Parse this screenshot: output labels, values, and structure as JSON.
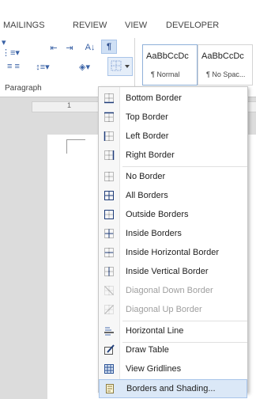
{
  "ribbon": {
    "tabs": [
      "MAILINGS",
      "REVIEW",
      "VIEW",
      "DEVELOPER"
    ],
    "group_label": "Paragraph",
    "styles": [
      {
        "sample": "AaBbCcDc",
        "name": "¶ Normal"
      },
      {
        "sample": "AaBbCcDc",
        "name": "¶ No Spac..."
      }
    ]
  },
  "ruler": {
    "number": "1"
  },
  "menu": {
    "items": [
      {
        "label": "Bottom Border",
        "icon": "bottom-border-icon",
        "enabled": true
      },
      {
        "label": "Top Border",
        "icon": "top-border-icon",
        "enabled": true
      },
      {
        "label": "Left Border",
        "icon": "left-border-icon",
        "enabled": true
      },
      {
        "label": "Right Border",
        "icon": "right-border-icon",
        "enabled": true
      },
      {
        "label": "No Border",
        "icon": "no-border-icon",
        "enabled": true
      },
      {
        "label": "All Borders",
        "icon": "all-borders-icon",
        "enabled": true
      },
      {
        "label": "Outside Borders",
        "icon": "outside-borders-icon",
        "enabled": true
      },
      {
        "label": "Inside Borders",
        "icon": "inside-borders-icon",
        "enabled": true
      },
      {
        "label": "Inside Horizontal Border",
        "icon": "inside-horizontal-border-icon",
        "enabled": true
      },
      {
        "label": "Inside Vertical Border",
        "icon": "inside-vertical-border-icon",
        "enabled": true
      },
      {
        "label": "Diagonal Down Border",
        "icon": "diagonal-down-border-icon",
        "enabled": false
      },
      {
        "label": "Diagonal Up Border",
        "icon": "diagonal-up-border-icon",
        "enabled": false
      },
      {
        "label": "Horizontal Line",
        "icon": "horizontal-line-icon",
        "enabled": true
      },
      {
        "label": "Draw Table",
        "icon": "draw-table-icon",
        "enabled": true
      },
      {
        "label": "View Gridlines",
        "icon": "view-gridlines-icon",
        "enabled": true
      },
      {
        "label": "Borders and Shading...",
        "icon": "borders-and-shading-icon",
        "enabled": true,
        "highlighted": true
      }
    ]
  }
}
